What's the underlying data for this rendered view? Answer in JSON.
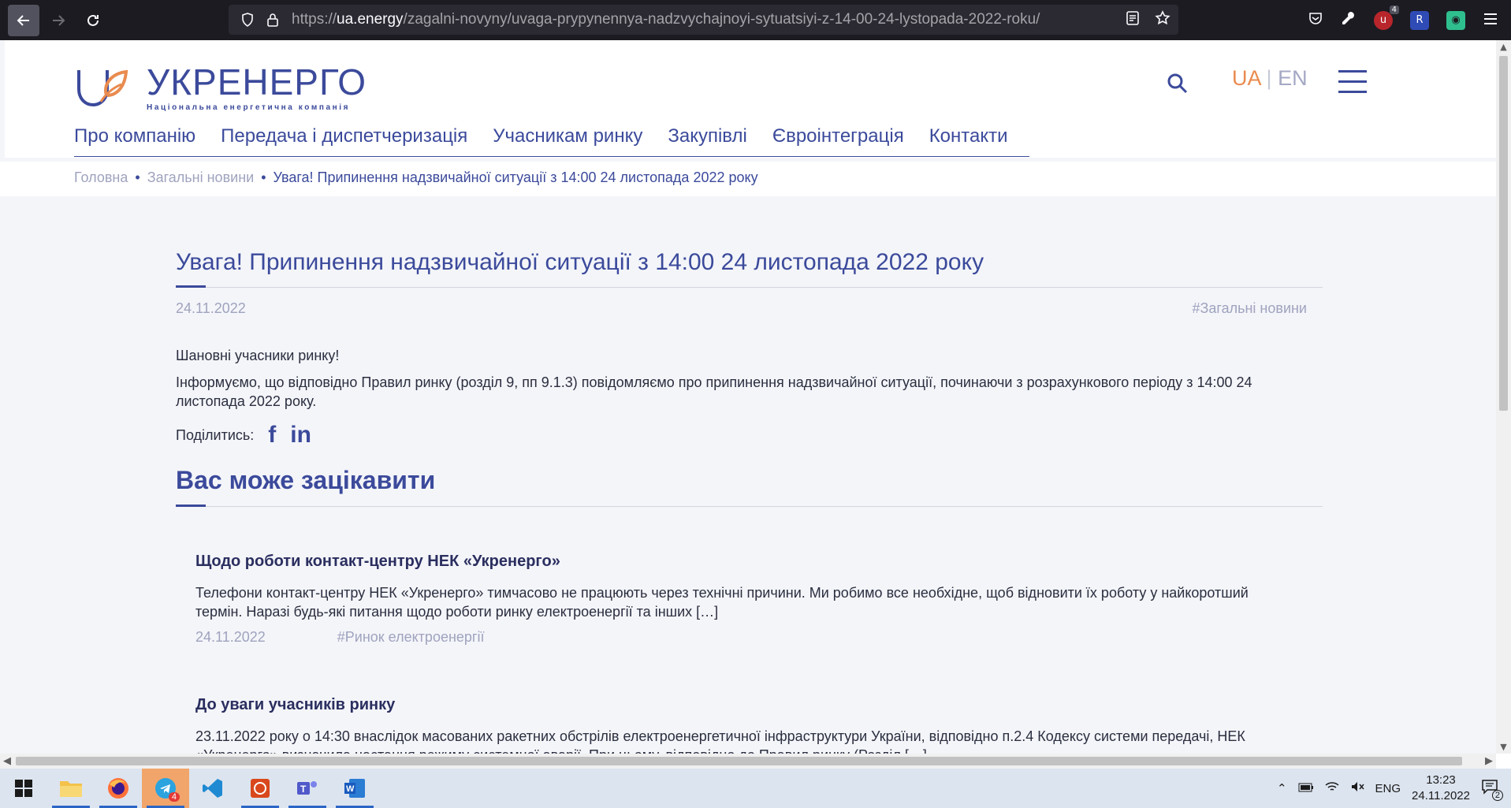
{
  "browser": {
    "url_prefix": "https://",
    "url_host": "ua.energy",
    "url_path": "/zagalni-novyny/uvaga-prypynennya-nadzvychajnoyi-sytuatsiyi-z-14-00-24-lystopada-2022-roku/",
    "extension_badge": "4"
  },
  "site": {
    "logo_name": "УКРЕНЕРГО",
    "logo_tagline": "Національна енергетична компанія",
    "lang_ua": "UA",
    "lang_sep": "|",
    "lang_en": "EN",
    "nav": [
      "Про компанію",
      "Передача і диспетчеризація",
      "Учасникам ринку",
      "Закупівлі",
      "Євроінтеграція",
      "Контакти"
    ]
  },
  "breadcrumb": {
    "home": "Головна",
    "section": "Загальні новини",
    "current": "Увага! Припинення надзвичайної ситуації з 14:00 24 листопада 2022 року",
    "sep": "•"
  },
  "article": {
    "title": "Увага! Припинення надзвичайної ситуації з 14:00 24 листопада 2022 року",
    "date": "24.11.2022",
    "tag": "#Загальні новини",
    "greeting": "Шановні учасники ринку!",
    "body": "Інформуємо, що відповідно Правил ринку (розділ 9, пп 9.1.3) повідомляємо про припинення надзвичайної ситуації, починаючи з розрахункового періоду з 14:00 24 листопада 2022 року.",
    "share_label": "Поділитись:",
    "share_fb": "f",
    "share_in": "in"
  },
  "related": {
    "title": "Вас може зацікавити",
    "items": [
      {
        "title": "Щодо роботи контакт-центру НЕК «Укренерго»",
        "excerpt": "Телефони контакт-центру НЕК «Укренерго» тимчасово не працюють через технічні причини. Ми робимо все необхідне, щоб відновити їх роботу у найкоротший термін. Наразі будь-які питання щодо роботи ринку електроенергії та інших […]",
        "date": "24.11.2022",
        "tag": "#Ринок електроенергії"
      },
      {
        "title": "До уваги учасників ринку",
        "excerpt": "23.11.2022 року о 14:30 внаслідок масованих ракетних обстрілів електроенергетичної інфраструктури України, відповідно п.2.4 Кодексу системи передачі, НЕК «Укренерго» визначила настання режиму системної аварії. При цьому, відповідно до Правил ринку (Розділ […]"
      }
    ]
  },
  "taskbar": {
    "telegram_badge": "4",
    "lang": "ENG",
    "time": "13:23",
    "date": "24.11.2022",
    "notif_count": "2"
  },
  "colors": {
    "brand": "#3b4a9b",
    "accent": "#e98b4f",
    "muted": "#9fa3be"
  }
}
